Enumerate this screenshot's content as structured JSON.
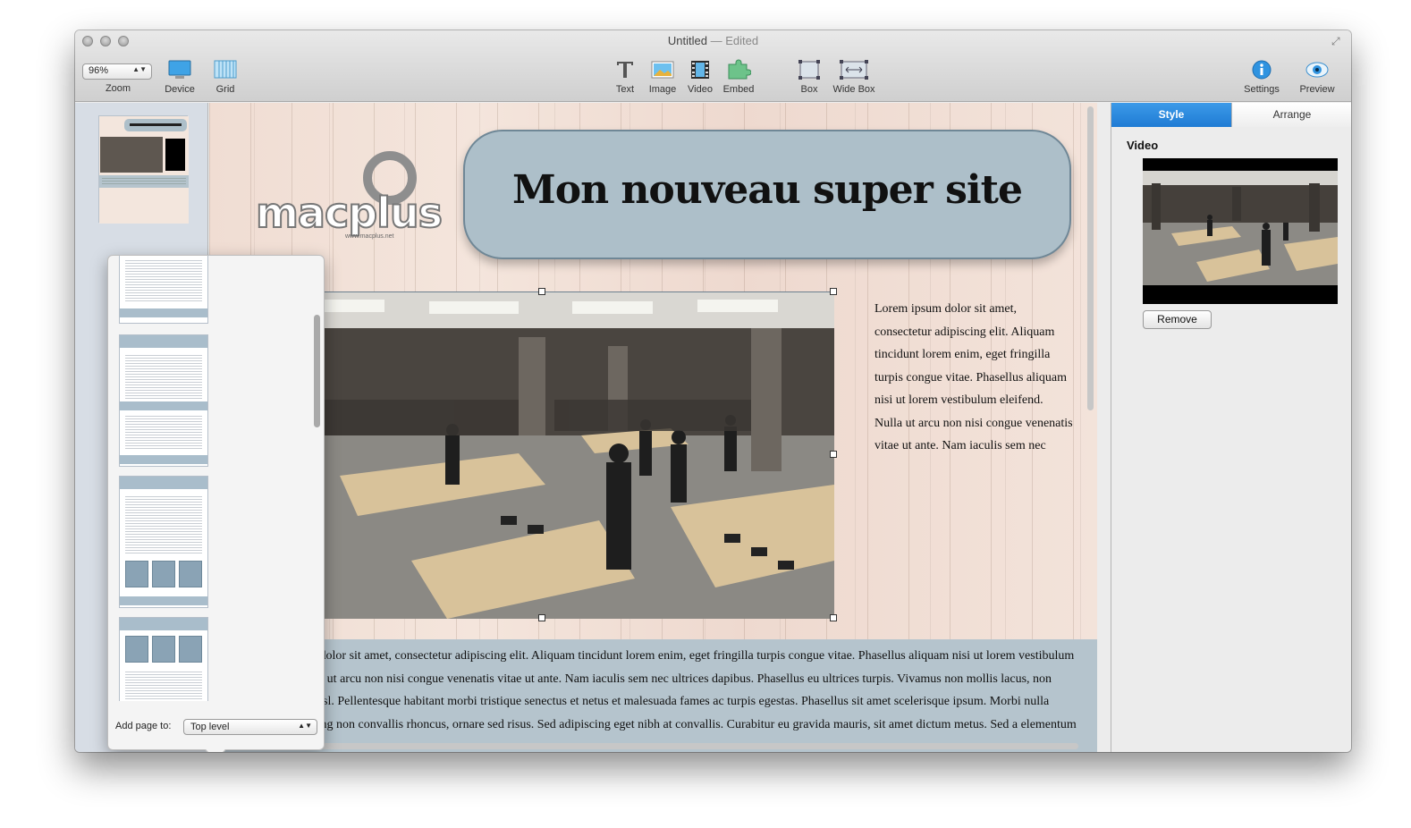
{
  "window": {
    "title": "Untitled",
    "title_suffix": "— Edited"
  },
  "toolbar": {
    "zoom": {
      "value": "96%",
      "label": "Zoom"
    },
    "device_label": "Device",
    "grid_label": "Grid",
    "text_label": "Text",
    "image_label": "Image",
    "video_label": "Video",
    "embed_label": "Embed",
    "box_label": "Box",
    "widebox_label": "Wide Box",
    "settings_label": "Settings",
    "preview_label": "Preview"
  },
  "popover": {
    "add_page_label": "Add page to:",
    "add_page_value": "Top level"
  },
  "canvas": {
    "logo_text": "macplus",
    "logo_url": "www.macplus.net",
    "header_title": "Mon nouveau super site",
    "side_text": "Lorem ipsum dolor sit amet, consectetur adipiscing elit. Aliquam tincidunt lorem enim, eget fringilla turpis congue vitae. Phasellus aliquam nisi ut lorem vestibulum eleifend. Nulla ut arcu non nisi congue venenatis vitae ut ante. Nam iaculis sem nec",
    "bottom_text": "Lorem ipsum dolor sit amet, consectetur adipiscing elit. Aliquam tincidunt lorem enim, eget fringilla turpis congue vitae. Phasellus aliquam nisi ut lorem vestibulum eleifend. Nulla ut arcu non nisi congue venenatis vitae ut ante. Nam iaculis sem nec ultrices dapibus. Phasellus eu ultrices turpis. Vivamus non mollis lacus, non ullamcorper nisl. Pellentesque habitant morbi tristique senectus et netus et malesuada fames ac turpis egestas. Phasellus sit amet scelerisque ipsum. Morbi nulla dolor, adipiscing non convallis rhoncus, ornare sed risus. Sed adipiscing eget nibh at convallis. Curabitur eu gravida mauris, sit amet dictum metus. Sed a elementum arcu. Proin"
  },
  "inspector": {
    "tabs": {
      "style": "Style",
      "arrange": "Arrange"
    },
    "section_label": "Video",
    "remove_label": "Remove"
  },
  "colors": {
    "accent": "#1f7bd4",
    "header_box": "#adbfc9",
    "band": "#b5c4cd"
  }
}
